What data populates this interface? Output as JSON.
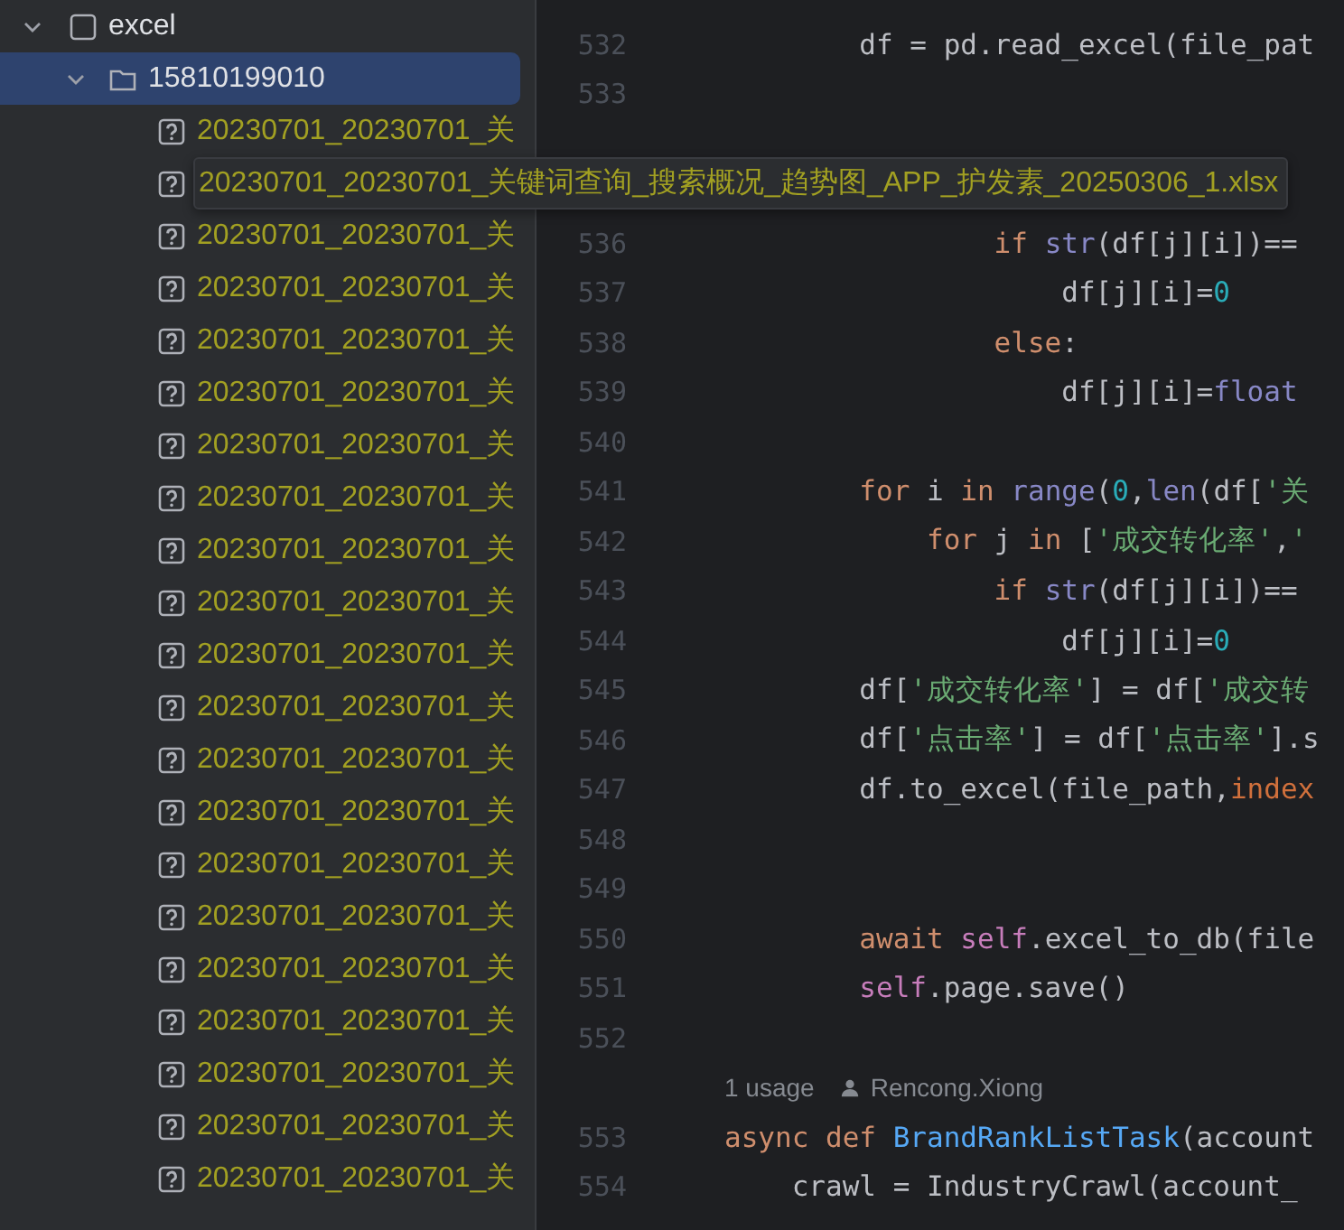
{
  "project_tree": {
    "label": "excel",
    "expanded": true,
    "children": [
      {
        "label": "15810199010",
        "selected": true,
        "expanded": true,
        "files": [
          {
            "name": "20230701_20230701_关",
            "hovered": false
          },
          {
            "name": "20230701_20230701_关键词查询_搜索概况_趋势图_APP_护发素_20250306_1.xlsx",
            "hovered": true
          },
          {
            "name": "20230701_20230701_关",
            "hovered": false
          },
          {
            "name": "20230701_20230701_关",
            "hovered": false
          },
          {
            "name": "20230701_20230701_关",
            "hovered": false
          },
          {
            "name": "20230701_20230701_关",
            "hovered": false
          },
          {
            "name": "20230701_20230701_关",
            "hovered": false
          },
          {
            "name": "20230701_20230701_关",
            "hovered": false
          },
          {
            "name": "20230701_20230701_关",
            "hovered": false
          },
          {
            "name": "20230701_20230701_关",
            "hovered": false
          },
          {
            "name": "20230701_20230701_关",
            "hovered": false
          },
          {
            "name": "20230701_20230701_关",
            "hovered": false
          },
          {
            "name": "20230701_20230701_关",
            "hovered": false
          },
          {
            "name": "20230701_20230701_关",
            "hovered": false
          },
          {
            "name": "20230701_20230701_关",
            "hovered": false
          },
          {
            "name": "20230701_20230701_关",
            "hovered": false
          },
          {
            "name": "20230701_20230701_关",
            "hovered": false
          },
          {
            "name": "20230701_20230701_关",
            "hovered": false
          },
          {
            "name": "20230701_20230701_关",
            "hovered": false
          },
          {
            "name": "20230701_20230701_关",
            "hovered": false
          },
          {
            "name": "20230701_20230701_关",
            "hovered": false
          }
        ]
      }
    ]
  },
  "editor": {
    "lines": [
      {
        "kind": "code",
        "number": "532",
        "tokens": [
          {
            "text": "        df = pd.read_excel(file_pat",
            "kind": "plain"
          }
        ]
      },
      {
        "kind": "code",
        "number": "533"
      },
      {
        "kind": "covered"
      },
      {
        "kind": "covered"
      },
      {
        "kind": "code",
        "number": "536",
        "tokens": [
          {
            "text": "                if ",
            "kind": "kw"
          },
          {
            "text": "str",
            "kind": "builtin"
          },
          {
            "text": "(df[j][i])==",
            "kind": "plain"
          }
        ]
      },
      {
        "kind": "code",
        "number": "537",
        "tokens": [
          {
            "text": "                    df[j][i]=",
            "kind": "plain"
          },
          {
            "text": "0",
            "kind": "num"
          }
        ]
      },
      {
        "kind": "code",
        "number": "538",
        "tokens": [
          {
            "text": "                else",
            "kind": "kw"
          },
          {
            "text": ":",
            "kind": "plain"
          }
        ]
      },
      {
        "kind": "code",
        "number": "539",
        "tokens": [
          {
            "text": "                    df[j][i]=",
            "kind": "plain"
          },
          {
            "text": "float",
            "kind": "builtin"
          }
        ]
      },
      {
        "kind": "code",
        "number": "540"
      },
      {
        "kind": "code",
        "number": "541",
        "tokens": [
          {
            "text": "        for ",
            "kind": "kw"
          },
          {
            "text": "i ",
            "kind": "plain"
          },
          {
            "text": "in ",
            "kind": "kw"
          },
          {
            "text": "range",
            "kind": "builtin"
          },
          {
            "text": "(",
            "kind": "plain"
          },
          {
            "text": "0",
            "kind": "num"
          },
          {
            "text": ",",
            "kind": "plain"
          },
          {
            "text": "len",
            "kind": "builtin"
          },
          {
            "text": "(df[",
            "kind": "plain"
          },
          {
            "text": "'关",
            "kind": "str"
          }
        ]
      },
      {
        "kind": "code",
        "number": "542",
        "tokens": [
          {
            "text": "            for ",
            "kind": "kw"
          },
          {
            "text": "j ",
            "kind": "plain"
          },
          {
            "text": "in ",
            "kind": "kw"
          },
          {
            "text": "[",
            "kind": "plain"
          },
          {
            "text": "'成交转化率'",
            "kind": "str"
          },
          {
            "text": ",",
            "kind": "plain"
          },
          {
            "text": "'",
            "kind": "str"
          }
        ]
      },
      {
        "kind": "code",
        "number": "543",
        "tokens": [
          {
            "text": "                if ",
            "kind": "kw"
          },
          {
            "text": "str",
            "kind": "builtin"
          },
          {
            "text": "(df[j][i])==",
            "kind": "plain"
          }
        ]
      },
      {
        "kind": "code",
        "number": "544",
        "tokens": [
          {
            "text": "                    df[j][i]=",
            "kind": "plain"
          },
          {
            "text": "0",
            "kind": "num"
          }
        ]
      },
      {
        "kind": "code",
        "number": "545",
        "tokens": [
          {
            "text": "        df[",
            "kind": "plain"
          },
          {
            "text": "'成交转化率'",
            "kind": "str"
          },
          {
            "text": "] = df[",
            "kind": "plain"
          },
          {
            "text": "'成交转",
            "kind": "str"
          }
        ]
      },
      {
        "kind": "code",
        "number": "546",
        "tokens": [
          {
            "text": "        df[",
            "kind": "plain"
          },
          {
            "text": "'点击率'",
            "kind": "str"
          },
          {
            "text": "] = df[",
            "kind": "plain"
          },
          {
            "text": "'点击率'",
            "kind": "str"
          },
          {
            "text": "].s",
            "kind": "plain"
          }
        ]
      },
      {
        "kind": "code",
        "number": "547",
        "tokens": [
          {
            "text": "        df.to_excel(file_path,",
            "kind": "plain"
          },
          {
            "text": "index",
            "kind": "param"
          }
        ]
      },
      {
        "kind": "code",
        "number": "548"
      },
      {
        "kind": "code",
        "number": "549"
      },
      {
        "kind": "code",
        "number": "550",
        "tokens": [
          {
            "text": "        await ",
            "kind": "kw"
          },
          {
            "text": "self",
            "kind": "self"
          },
          {
            "text": ".excel_to_db(file",
            "kind": "plain"
          }
        ]
      },
      {
        "kind": "code",
        "number": "551",
        "tokens": [
          {
            "text": "        self",
            "kind": "self"
          },
          {
            "text": ".page.save()",
            "kind": "plain"
          }
        ]
      },
      {
        "kind": "code",
        "number": "552"
      },
      {
        "kind": "hint",
        "usage": "1 usage",
        "author": "Rencong.Xiong"
      },
      {
        "kind": "code",
        "number": "553",
        "tokens": [
          {
            "text": "async def ",
            "kind": "kw"
          },
          {
            "text": "BrandRankListTask",
            "kind": "fn"
          },
          {
            "text": "(account",
            "kind": "plain"
          }
        ]
      },
      {
        "kind": "code",
        "number": "554",
        "tokens": [
          {
            "text": "    crawl = IndustryCrawl(account_",
            "kind": "plain"
          }
        ]
      }
    ]
  }
}
